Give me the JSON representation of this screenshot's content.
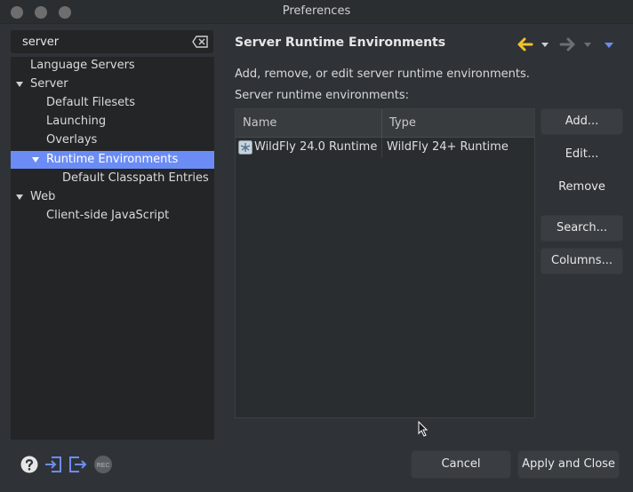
{
  "window": {
    "title": "Preferences"
  },
  "filter": {
    "value": "server"
  },
  "tree": {
    "items": [
      {
        "label": "Language Servers",
        "expanded": null,
        "selected": false
      },
      {
        "label": "Server",
        "expanded": true,
        "selected": false
      },
      {
        "label": "Default Filesets",
        "expanded": null,
        "selected": false
      },
      {
        "label": "Launching",
        "expanded": null,
        "selected": false
      },
      {
        "label": "Overlays",
        "expanded": null,
        "selected": false
      },
      {
        "label": "Runtime Environments",
        "expanded": true,
        "selected": true
      },
      {
        "label": "Default Classpath Entries",
        "expanded": null,
        "selected": false
      },
      {
        "label": "Web",
        "expanded": true,
        "selected": false
      },
      {
        "label": "Client-side JavaScript",
        "expanded": null,
        "selected": false
      }
    ]
  },
  "page": {
    "title": "Server Runtime Environments",
    "description": "Add, remove, or edit server runtime environments.",
    "list_label": "Server runtime environments:"
  },
  "table": {
    "columns": [
      "Name",
      "Type"
    ],
    "rows": [
      {
        "name": "WildFly 24.0 Runtime",
        "type": "WildFly 24+ Runtime",
        "icon": "wildfly-icon"
      }
    ]
  },
  "buttons": {
    "add": "Add...",
    "edit": "Edit...",
    "remove": "Remove",
    "search": "Search...",
    "columns": "Columns...",
    "cancel": "Cancel",
    "apply_close": "Apply and Close"
  },
  "bottom_icons": [
    "help-icon",
    "import-icon",
    "export-icon",
    "record-icon"
  ],
  "colors": {
    "accent_selection": "#6c8cf5",
    "back_arrow": "#f2c12e",
    "nav_dropdown": "#6c8cf5"
  }
}
